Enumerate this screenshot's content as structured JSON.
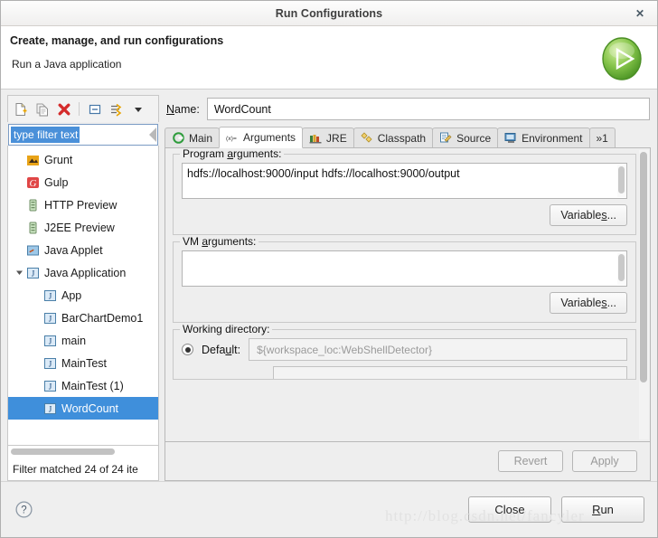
{
  "window": {
    "title": "Run Configurations",
    "close_icon": "close-icon"
  },
  "header": {
    "title": "Create, manage, and run configurations",
    "subtitle": "Run a Java application",
    "icon": "run-launch-icon"
  },
  "tree_toolbar": {
    "buttons": [
      {
        "name": "new-configuration-icon",
        "label": "New launch configuration"
      },
      {
        "name": "duplicate-configuration-icon",
        "label": "Duplicate"
      },
      {
        "name": "delete-configuration-icon",
        "label": "Delete"
      },
      {
        "name": "collapse-all-icon",
        "label": "Collapse All"
      },
      {
        "name": "filter-launch-icon",
        "label": "Filter launch configurations"
      },
      {
        "name": "view-menu-chevron-icon",
        "label": "View Menu"
      }
    ]
  },
  "filter": {
    "value": "type filter text",
    "placeholder": "type filter text",
    "status": "Filter matched 24 of 24 ite"
  },
  "tree": {
    "items": [
      {
        "label": "Grunt",
        "icon": "grunt-icon",
        "indent": 1,
        "selected": false,
        "twisty": ""
      },
      {
        "label": "Gulp",
        "icon": "gulp-icon",
        "indent": 1,
        "selected": false,
        "twisty": ""
      },
      {
        "label": "HTTP Preview",
        "icon": "server-icon",
        "indent": 1,
        "selected": false,
        "twisty": ""
      },
      {
        "label": "J2EE Preview",
        "icon": "server-icon",
        "indent": 1,
        "selected": false,
        "twisty": ""
      },
      {
        "label": "Java Applet",
        "icon": "java-applet-icon",
        "indent": 1,
        "selected": false,
        "twisty": ""
      },
      {
        "label": "Java Application",
        "icon": "java-app-icon",
        "indent": 0,
        "selected": false,
        "twisty": "expanded"
      },
      {
        "label": "App",
        "icon": "java-app-icon",
        "indent": 2,
        "selected": false,
        "twisty": ""
      },
      {
        "label": "BarChartDemo1",
        "icon": "java-app-icon",
        "indent": 2,
        "selected": false,
        "twisty": ""
      },
      {
        "label": "main",
        "icon": "java-app-icon",
        "indent": 2,
        "selected": false,
        "twisty": ""
      },
      {
        "label": "MainTest",
        "icon": "java-app-icon",
        "indent": 2,
        "selected": false,
        "twisty": ""
      },
      {
        "label": "MainTest (1)",
        "icon": "java-app-icon",
        "indent": 2,
        "selected": false,
        "twisty": ""
      },
      {
        "label": "WordCount",
        "icon": "java-app-icon",
        "indent": 2,
        "selected": true,
        "twisty": ""
      }
    ]
  },
  "name_field": {
    "label": "Name:",
    "label_mnemonic": "N",
    "value": "WordCount"
  },
  "tabs": [
    {
      "label": "Main",
      "icon": "main-tab-icon",
      "active": false
    },
    {
      "label": "Arguments",
      "icon": "arguments-tab-icon",
      "active": true
    },
    {
      "label": "JRE",
      "icon": "jre-tab-icon",
      "active": false
    },
    {
      "label": "Classpath",
      "icon": "classpath-tab-icon",
      "active": false
    },
    {
      "label": "Source",
      "icon": "source-tab-icon",
      "active": false
    },
    {
      "label": "Environment",
      "icon": "environment-tab-icon",
      "active": false
    },
    {
      "label": "»1",
      "icon": "overflow-tab-icon",
      "active": false
    }
  ],
  "arguments_tab": {
    "program_arguments": {
      "legend": "Program arguments:",
      "legend_mnemonic": "a",
      "value": "hdfs://localhost:9000/input hdfs://localhost:9000/output",
      "variables_button": "Variables...",
      "variables_mnemonic": "s"
    },
    "vm_arguments": {
      "legend": "VM arguments:",
      "legend_mnemonic": "a",
      "value": "",
      "variables_button": "Variables...",
      "variables_mnemonic": "s"
    },
    "working_directory": {
      "legend": "Working directory:",
      "default_radio_label": "Default:",
      "default_radio_mnemonic": "u",
      "default_selected": true,
      "default_value": "${workspace_loc:WebShellDetector}"
    }
  },
  "apply_bar": {
    "revert_label": "Revert",
    "revert_enabled": false,
    "apply_label": "Apply",
    "apply_enabled": false
  },
  "footer": {
    "help_icon": "help-icon",
    "close_label": "Close",
    "run_label": "Run",
    "run_mnemonic": "R",
    "watermark": "http://blog.csdn.net/fancyler"
  },
  "colors": {
    "selection_blue": "#3f8fdb",
    "filter_selection_blue": "#4a90d9",
    "delete_red": "#d42b2b",
    "run_green": "#5aab34",
    "dialog_bg": "#eeeeee"
  }
}
